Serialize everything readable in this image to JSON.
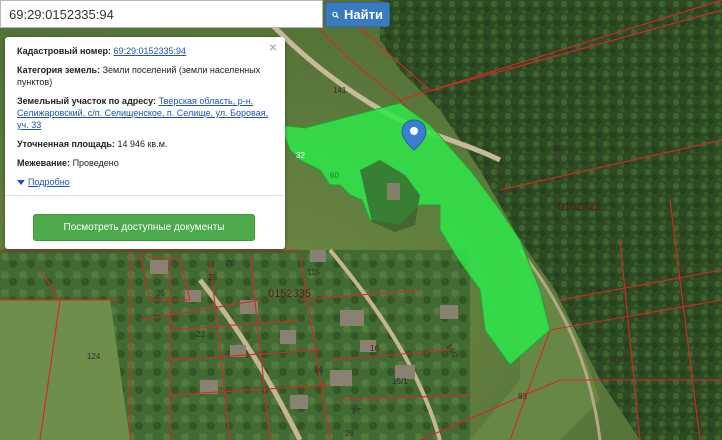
{
  "search": {
    "value": "69:29:0152335:94",
    "button_label": "Найти",
    "icon": "search-icon"
  },
  "popup": {
    "cadastral_label": "Кадастровый номер:",
    "cadastral_value": "69:29:0152335:94",
    "category_label": "Категория земель:",
    "category_value": "Земли поселений (земли населенных пунктов)",
    "address_label": "Земельный участок по адресу:",
    "address_value": "Тверская область, р-н. Селижаровский, с/п. Селищенское, п. Селище, ул. Боровая, уч. 33",
    "area_label": "Уточненная площадь:",
    "area_value": "14 946 кв.м.",
    "survey_label": "Межевание:",
    "survey_value": "Проведено",
    "more_label": "Подробно",
    "docs_button": "Посмотреть доступные документы"
  },
  "map_labels": {
    "q1": "0152322",
    "q2": "0152335",
    "p252": "252",
    "p251": "251",
    "p262": "262",
    "p141": "141",
    "p32": "32",
    "p76": "76",
    "p115": "115",
    "p25": "25",
    "p23": "23",
    "p124": "124",
    "p16": "16",
    "p84": "84",
    "p15_1": "15/1",
    "p15_2": "15/2",
    "p27": "27",
    "p28": "28",
    "p83": "83",
    "p60": "60",
    "p25b": "25"
  },
  "colors": {
    "parcel": "#2ee84a",
    "boundary": "#d8262b",
    "button": "#3a7abf",
    "docs_button": "#4caa4a",
    "marker": "#3b7fd4"
  }
}
